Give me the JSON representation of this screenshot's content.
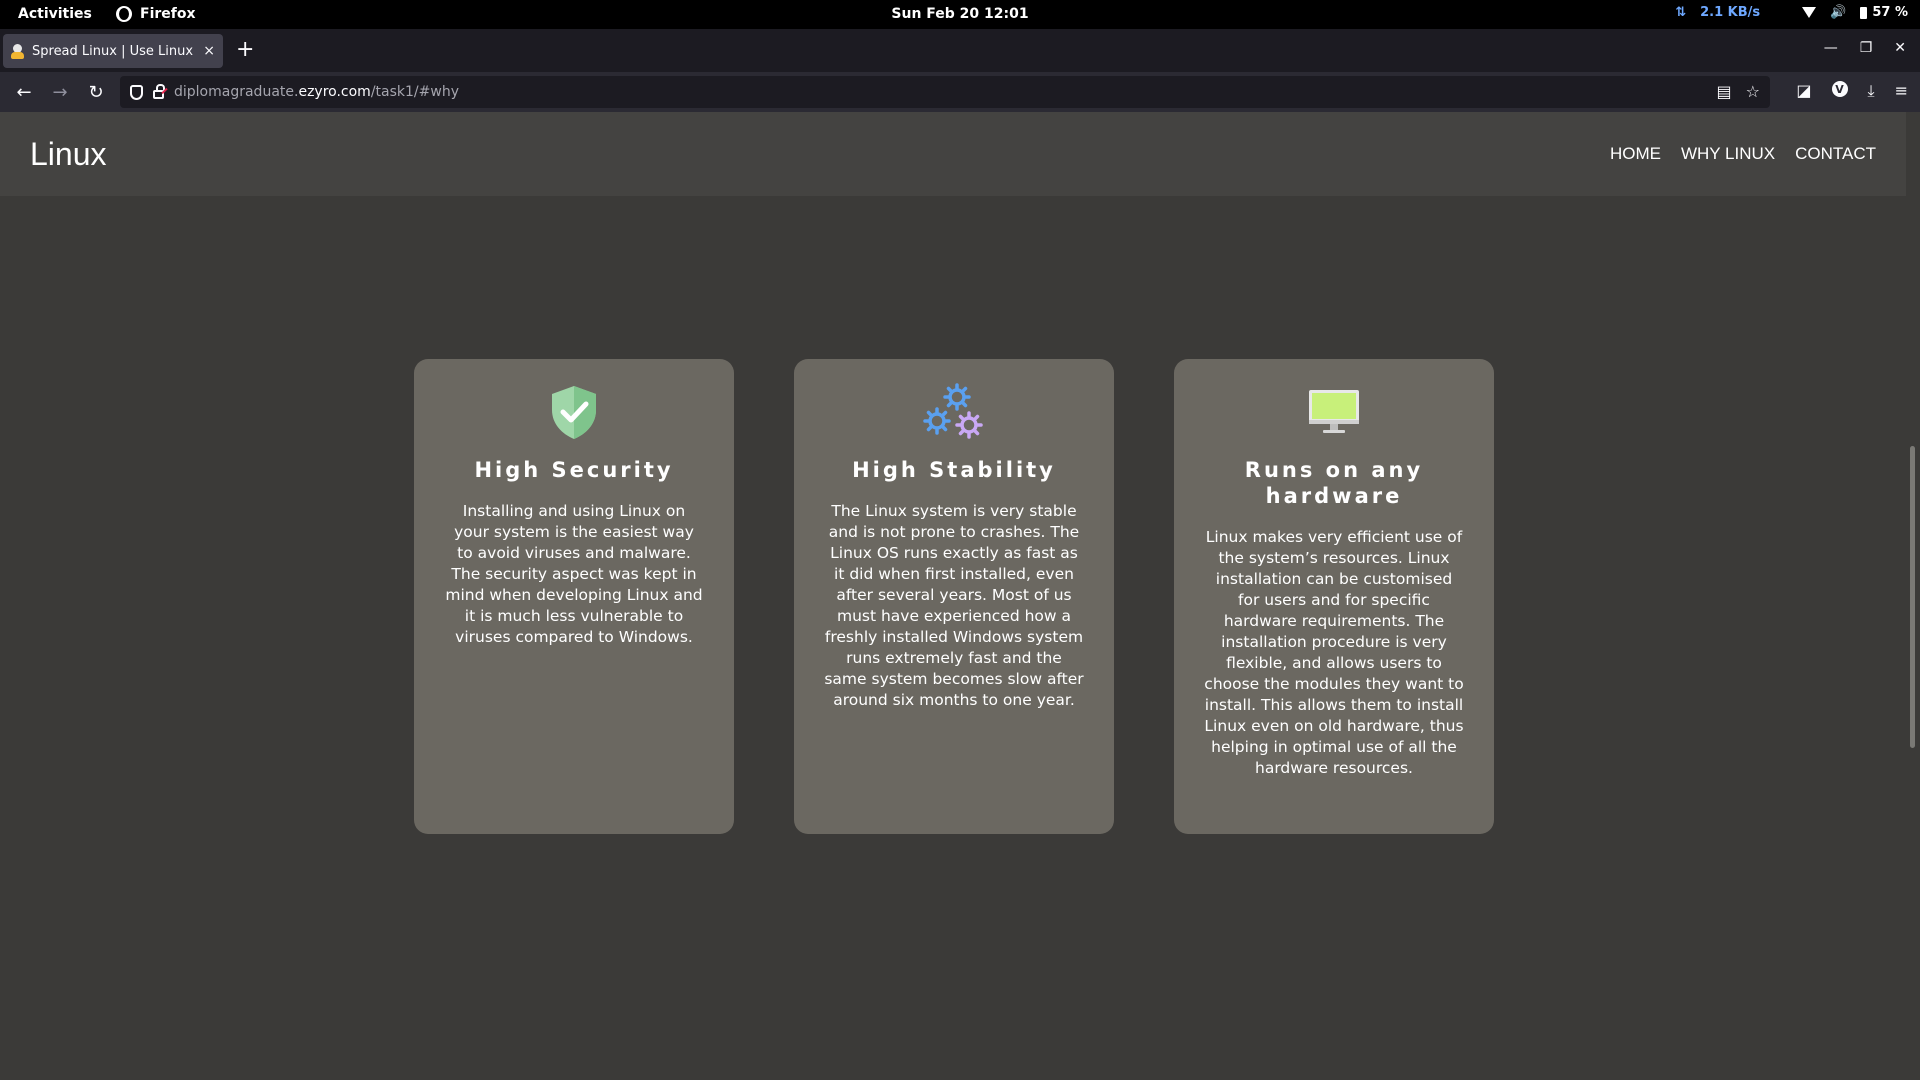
{
  "system_bar": {
    "activities": "Activities",
    "app_name": "Firefox",
    "clock": "Sun Feb 20  12:01",
    "net_arrows": "⇅",
    "net_speed": "2.1 KB/s",
    "battery": "57 %"
  },
  "browser": {
    "tab_title": "Spread Linux | Use Linux |",
    "tab_close": "×",
    "new_tab": "+",
    "url_host_prefix": "diplomagraduate.",
    "url_host_main": "ezyro.com",
    "url_path": "/task1/#why",
    "ext_letter": "V"
  },
  "site": {
    "brand": "Linux",
    "nav": [
      "HOME",
      "WHY LINUX",
      "CONTACT"
    ]
  },
  "cards": [
    {
      "title": "High Security",
      "text": "Installing and using Linux on your system is the easiest way to avoid viruses and malware. The security aspect was kept in mind when developing Linux and it is much less vulnerable to viruses compared to Windows."
    },
    {
      "title": "High Stability",
      "text": "The Linux system is very stable and is not prone to crashes. The Linux OS runs exactly as fast as it did when first installed, even after several years. Most of us must have experienced how a freshly installed Windows system runs extremely fast and the same system becomes slow after around six months to one year."
    },
    {
      "title": "Runs on any hardware",
      "text": "Linux makes very efficient use of the system’s resources. Linux installation can be customised for users and for specific hardware requirements. The installation procedure is very flexible, and allows users to choose the modules they want to install. This allows them to install Linux even on old hardware, thus helping in optimal use of all the hardware resources."
    }
  ],
  "icons": {
    "card1": "shield-check-icon",
    "card2": "gears-icon",
    "card3": "monitor-icon"
  },
  "colors": {
    "card_bg": "#6b6861",
    "page_bg": "#3b3a38",
    "header_bg": "#444341",
    "shield": "#9fd6a8",
    "monitor_screen": "#c8f07a",
    "gear_blue": "#5aa0f0",
    "gear_purple": "#c9a8f5"
  }
}
